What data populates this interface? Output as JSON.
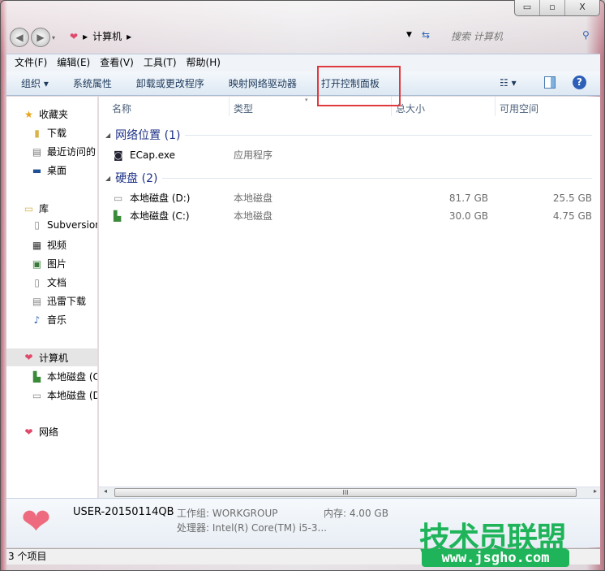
{
  "window": {
    "minimize": "▭",
    "maximize": "▫",
    "close": "X"
  },
  "address": {
    "root_icon": "heart-icon",
    "location": "计算机",
    "search_placeholder": "搜索 计算机"
  },
  "menu": [
    "文件(F)",
    "编辑(E)",
    "查看(V)",
    "工具(T)",
    "帮助(H)"
  ],
  "toolbar": {
    "organize": "组织 ▾",
    "items": [
      "系统属性",
      "卸载或更改程序",
      "映射网络驱动器",
      "打开控制面板"
    ],
    "highlight_color": "#e0393e"
  },
  "sidebar": {
    "favorites": {
      "label": "收藏夹",
      "items": [
        "下载",
        "最近访问的",
        "桌面"
      ]
    },
    "libraries": {
      "label": "库",
      "items": [
        "Subversion",
        "视频",
        "图片",
        "文档",
        "迅雷下载",
        "音乐"
      ]
    },
    "computer": {
      "label": "计算机",
      "items": [
        "本地磁盘 (C:)",
        "本地磁盘 (D:)"
      ]
    },
    "network": {
      "label": "网络"
    }
  },
  "columns": [
    "名称",
    "类型",
    "总大小",
    "可用空间"
  ],
  "groups": [
    {
      "title": "网络位置 (1)",
      "rows": [
        {
          "name": "ECap.exe",
          "type": "应用程序",
          "total": "",
          "free": ""
        }
      ]
    },
    {
      "title": "硬盘 (2)",
      "rows": [
        {
          "name": "本地磁盘 (D:)",
          "type": "本地磁盘",
          "total": "81.7 GB",
          "free": "25.5 GB"
        },
        {
          "name": "本地磁盘 (C:)",
          "type": "本地磁盘",
          "total": "30.0 GB",
          "free": "4.75 GB"
        }
      ]
    }
  ],
  "details": {
    "computer_name": "USER-20150114QB",
    "workgroup": "工作组: WORKGROUP",
    "memory": "内存: 4.00 GB",
    "processor": "处理器: Intel(R) Core(TM) i5-3..."
  },
  "status": "3 个项目",
  "watermark": {
    "title": "技术员联盟",
    "url": "www.jsgho.com"
  }
}
